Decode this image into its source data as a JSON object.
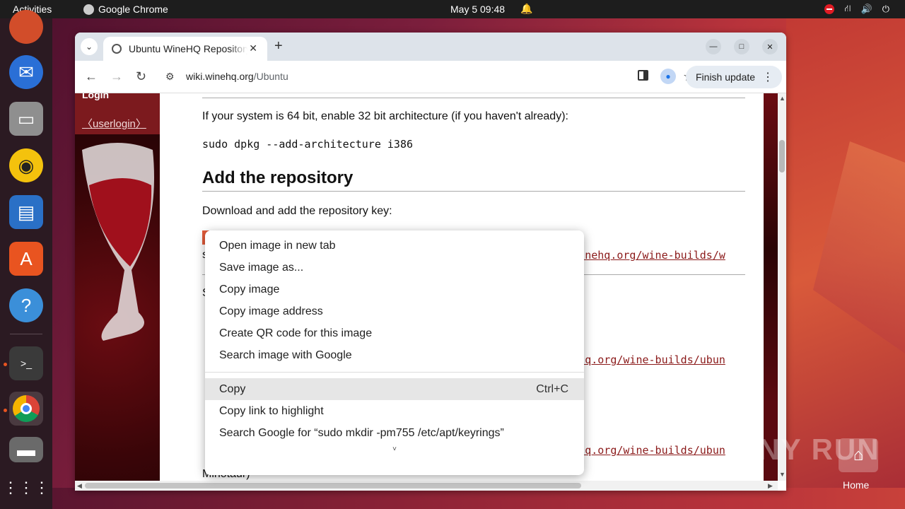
{
  "topbar": {
    "activities": "Activities",
    "app_name": "Google Chrome",
    "clock": "May 5  09:48",
    "icons": [
      "bell-icon",
      "dnd-icon",
      "network-icon",
      "volume-icon",
      "power-icon"
    ]
  },
  "dock": {
    "items": [
      "firefox",
      "thunderbird",
      "files",
      "rhythmbox",
      "libreoffice-writer",
      "app-center",
      "help",
      "terminal",
      "chrome",
      "disk",
      "app-grid"
    ]
  },
  "browser": {
    "tab_title": "Ubuntu WineHQ Repository",
    "url_host": "wiki.winehq.org",
    "url_path": "/Ubuntu",
    "finish_update": "Finish update"
  },
  "page": {
    "login": "Login",
    "userlogin": "〈userlogin〉",
    "para1": "If your system is 64 bit, enable 32 bit architecture (if you haven't already):",
    "cmd1": "sudo dpkg --add-architecture i386",
    "heading": "Add the repository",
    "para2": "Download and add the repository key:",
    "link1": "//dl.winehq.org/wine-builds/w",
    "link2": "l.winehq.org/wine-builds/ubun",
    "link3": "l.winehq.org/wine-builds/ubun",
    "bottom_text": "Minotaur)",
    "stray_s1": "s",
    "stray_s2": "S"
  },
  "context_menu": {
    "items": [
      {
        "label": "Open image in new tab"
      },
      {
        "label": "Save image as..."
      },
      {
        "label": "Copy image"
      },
      {
        "label": "Copy image address"
      },
      {
        "label": "Create QR code for this image"
      },
      {
        "label": "Search image with Google"
      }
    ],
    "items2": [
      {
        "label": "Copy",
        "shortcut": "Ctrl+C"
      },
      {
        "label": "Copy link to highlight"
      },
      {
        "label": "Search Google for “sudo mkdir -pm755 /etc/apt/keyrings”"
      }
    ],
    "more": "˅"
  },
  "desktop": {
    "watermark": "ANY RUN",
    "home_label": "Home"
  }
}
